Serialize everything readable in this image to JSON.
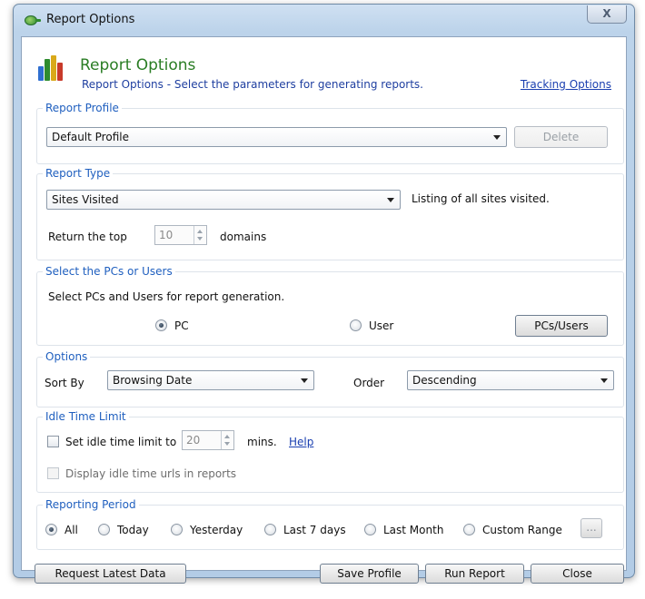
{
  "window": {
    "title": "Report Options",
    "close_label": "X"
  },
  "header": {
    "title": "Report Options",
    "subtitle": "Report Options - Select the parameters for generating reports.",
    "tracking_link": "Tracking Options"
  },
  "report_profile": {
    "label": "Report Profile",
    "selected": "Default Profile",
    "delete_label": "Delete"
  },
  "report_type": {
    "label": "Report Type",
    "selected": "Sites Visited",
    "description": "Listing of all sites visited.",
    "return_prefix": "Return the top",
    "top_value": "10",
    "return_suffix": "domains"
  },
  "pcs_users": {
    "label": "Select the PCs or Users",
    "instruction": "Select PCs and Users for report generation.",
    "option_pc": "PC",
    "option_user": "User",
    "selected": "PC",
    "button_label": "PCs/Users"
  },
  "options": {
    "label": "Options",
    "sort_by_label": "Sort By",
    "sort_by_value": "Browsing Date",
    "order_label": "Order",
    "order_value": "Descending"
  },
  "idle": {
    "label": "Idle Time Limit",
    "set_limit_label": "Set idle time limit to",
    "limit_value": "20",
    "mins_label": "mins.",
    "help_link": "Help",
    "display_urls_label": "Display idle time urls in reports"
  },
  "period": {
    "label": "Reporting Period",
    "options": [
      "All",
      "Today",
      "Yesterday",
      "Last 7 days",
      "Last Month",
      "Custom Range"
    ],
    "selected": "All",
    "custom_button": "..."
  },
  "footer": {
    "request_label": "Request Latest Data",
    "save_label": "Save Profile",
    "run_label": "Run Report",
    "close_label": "Close"
  },
  "colors": {
    "accent_green": "#2a7d24",
    "group_label_blue": "#1f5fbf",
    "link_blue": "#1a3fb0"
  }
}
